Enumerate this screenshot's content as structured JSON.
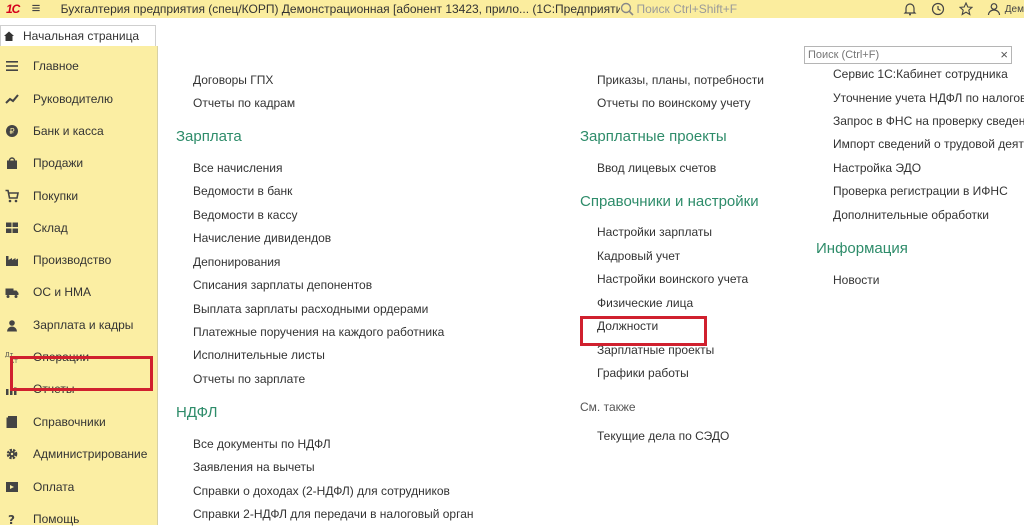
{
  "titlebar": {
    "logo": "1С",
    "title": "Бухгалтерия предприятия (спец/КОРП) Демонстрационная [абонент 13423, прило...   (1С:Предприятие)",
    "search_placeholder": "Поиск Ctrl+Shift+F",
    "user": "Дем"
  },
  "tabs": {
    "home": "Начальная страница"
  },
  "sidebar": {
    "items": [
      {
        "label": "Главное",
        "icon": "menu-lines-icon"
      },
      {
        "label": "Руководителю",
        "icon": "trend-icon"
      },
      {
        "label": "Банк и касса",
        "icon": "coin-icon"
      },
      {
        "label": "Продажи",
        "icon": "bag-icon"
      },
      {
        "label": "Покупки",
        "icon": "cart-icon"
      },
      {
        "label": "Склад",
        "icon": "warehouse-icon"
      },
      {
        "label": "Производство",
        "icon": "factory-icon"
      },
      {
        "label": "ОС и НМА",
        "icon": "truck-icon"
      },
      {
        "label": "Зарплата и кадры",
        "icon": "person-icon"
      },
      {
        "label": "Операции",
        "icon": "dt-kt-icon"
      },
      {
        "label": "Отчеты",
        "icon": "bar-chart-icon"
      },
      {
        "label": "Справочники",
        "icon": "book-icon"
      },
      {
        "label": "Администрирование",
        "icon": "gear-icon"
      },
      {
        "label": "Оплата",
        "icon": "payment-icon"
      },
      {
        "label": "Помощь",
        "icon": "question-icon"
      }
    ]
  },
  "main": {
    "search_placeholder": "Поиск (Ctrl+F)",
    "col1": {
      "top_links": [
        "Договоры ГПХ",
        "Отчеты по кадрам"
      ],
      "salary_heading": "Зарплата",
      "salary_links": [
        "Все начисления",
        "Ведомости в банк",
        "Ведомости в кассу",
        "Начисление дивидендов",
        "Депонирования",
        "Списания зарплаты депонентов",
        "Выплата зарплаты расходными ордерами",
        "Платежные поручения на каждого работника",
        "Исполнительные листы",
        "Отчеты по зарплате"
      ],
      "ndfl_heading": "НДФЛ",
      "ndfl_links": [
        "Все документы по НДФЛ",
        "Заявления на вычеты",
        "Справки о доходах (2-НДФЛ) для сотрудников",
        "Справки 2-НДФЛ для передачи в налоговый орган"
      ]
    },
    "col2": {
      "top_links": [
        "Приказы, планы, потребности",
        "Отчеты по воинскому учету"
      ],
      "projects_heading": "Зарплатные проекты",
      "projects_links": [
        "Ввод лицевых счетов"
      ],
      "settings_heading": "Справочники и настройки",
      "settings_links": [
        "Настройки зарплаты",
        "Кадровый учет",
        "Настройки воинского учета",
        "Физические лица",
        "Должности",
        "Зарплатные проекты",
        "Графики работы"
      ],
      "see_also": "См. также",
      "see_also_links": [
        "Текущие дела по СЭДО"
      ]
    },
    "col3": {
      "top_links": [
        "Сервис 1С:Кабинет сотрудника",
        "Уточнение учета НДФЛ по налоговым",
        "Запрос в ФНС на проверку сведений",
        "Импорт сведений о трудовой деятельности",
        "Настройка ЭДО",
        "Проверка регистрации в ИФНС",
        "Дополнительные обработки"
      ],
      "info_heading": "Информация",
      "info_links": [
        "Новости"
      ]
    }
  },
  "colors": {
    "sidebar_bg": "#fbeea3",
    "heading": "#2e8c6a",
    "highlight": "#d0202e",
    "titlebar": "#fbed9e"
  }
}
